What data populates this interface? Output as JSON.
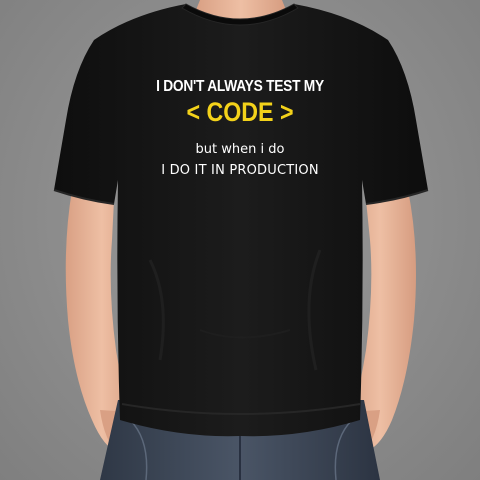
{
  "shirt_print": {
    "line1": "I DON'T ALWAYS TEST MY",
    "line2": "< CODE >",
    "line3": "but when i do",
    "line4": "I DO IT IN PRODUCTION"
  },
  "colors": {
    "background": "#8c8c8c",
    "shirt": "#141414",
    "skin": "#e8b79c",
    "jeans": "#3d4757",
    "print_white": "#ffffff",
    "print_yellow": "#f3d21a"
  }
}
